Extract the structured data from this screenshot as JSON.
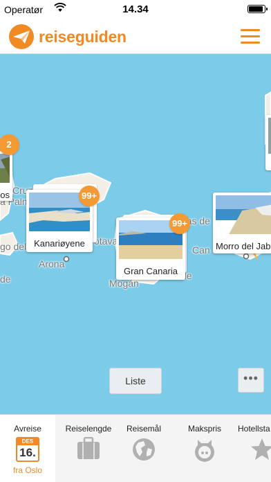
{
  "status": {
    "carrier": "Operatør",
    "time": "14.34",
    "battery_level": 0.95
  },
  "header": {
    "brand": "reiseguiden",
    "brand_color": "#f08a24",
    "menu_icon": "hamburger-menu-icon"
  },
  "map": {
    "water_color": "#7ccbe9",
    "labels": {
      "cruz": "Cruz",
      "palma": "a Palm",
      "os": "os",
      "go_del": "go del",
      "arona": "Arona",
      "de1": "de",
      "otava": "otava",
      "mas_de": "mas de",
      "can": "Can",
      "mogan": "Mogán",
      "de2": "de"
    },
    "cards": [
      {
        "label": "os",
        "badge": "2"
      },
      {
        "label": "Kanariøyene",
        "badge": "99+"
      },
      {
        "label": "Gran Canaria",
        "badge": "99+"
      },
      {
        "label": "Morro del Jable",
        "badge": ""
      }
    ],
    "list_button": "Liste",
    "more_button": "•••"
  },
  "tabs": [
    {
      "label": "Avreise",
      "icon": "calendar-icon",
      "cal_month": "DES",
      "cal_day": "16.",
      "sub": "fra Oslo"
    },
    {
      "label": "Reiselengde",
      "icon": "suitcase-icon"
    },
    {
      "label": "Reisemål",
      "icon": "globe-icon"
    },
    {
      "label": "Makspris",
      "icon": "piggy-bank-icon"
    },
    {
      "label": "Hotellsta",
      "icon": "star-icon"
    }
  ]
}
